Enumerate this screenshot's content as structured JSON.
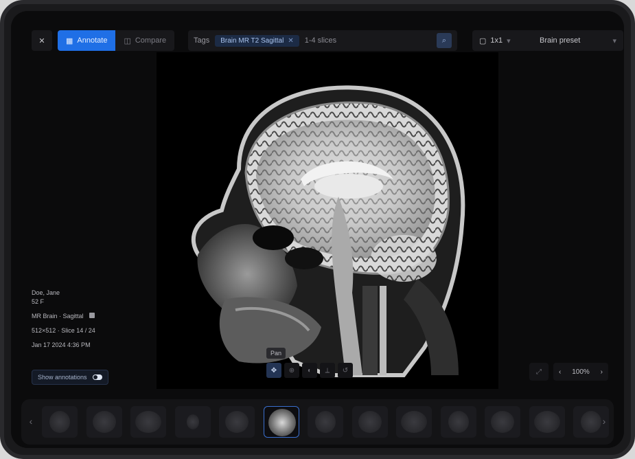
{
  "toolbar": {
    "close_icon": "close-icon",
    "tabs": [
      {
        "label": "Annotate",
        "icon": "grid-icon",
        "active": true
      },
      {
        "label": "Compare",
        "icon": "compare-icon",
        "active": false
      }
    ],
    "search": {
      "prefix": "Tags",
      "chip": "Brain MR T2 Sagittal",
      "query": "1-4 slices",
      "go_icon": "search-icon"
    },
    "grid_dropdown": {
      "label": "1x1",
      "icon": "layout-icon"
    },
    "window_dropdown": {
      "label": "Brain preset"
    }
  },
  "overlay": {
    "patient_line1": "Doe, Jane",
    "patient_line2": "52 F",
    "series": "MR Brain · Sagittal",
    "params": "512×512 · Slice 14 / 24",
    "date": "Jan 17 2024 4:36 PM",
    "annotations_label": "Show annotations"
  },
  "viewer_tools": {
    "tooltip": "Pan",
    "tools": [
      "pan-icon",
      "zoom-icon",
      "contrast-icon",
      "measure-icon",
      "reset-icon"
    ]
  },
  "zoom": {
    "value": "100%"
  },
  "filmstrip": {
    "count": 13,
    "selected_index": 5
  },
  "colors": {
    "accent": "#1f6fe6",
    "background": "#0b0b0c"
  }
}
